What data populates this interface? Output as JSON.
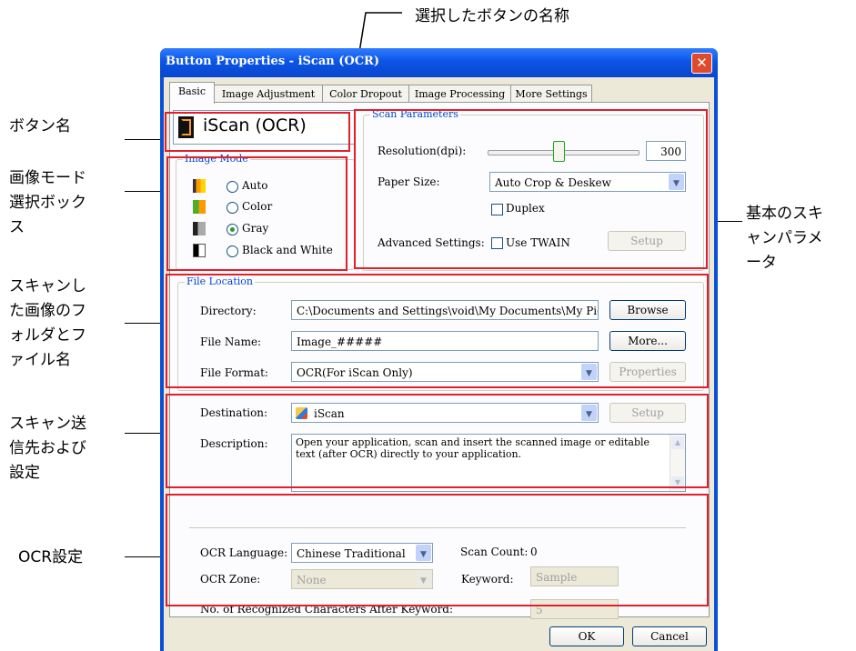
{
  "annotations": {
    "top": "選択したボタンの名称",
    "button_name": "ボタン名",
    "image_mode": [
      "画像モード",
      "選択ボック",
      "ス"
    ],
    "scan_params": [
      "基本のスキ",
      "ャンパラメ",
      "ータ"
    ],
    "file_location": [
      "スキャンし",
      "た画像のフ",
      "ォルダとフ",
      "ァイル名"
    ],
    "destination": [
      "スキャン送",
      "信先および",
      "設定"
    ],
    "ocr": "OCR設定"
  },
  "dialog": {
    "title": "Button Properties - iScan (OCR)",
    "close_glyph": "✕",
    "tabs": [
      "Basic",
      "Image Adjustment",
      "Color Dropout",
      "Image Processing",
      "More Settings"
    ],
    "button_name": "iScan (OCR)",
    "image_mode": {
      "label": "Image Mode",
      "options": [
        "Auto",
        "Color",
        "Gray",
        "Black and White"
      ],
      "selected": "Gray"
    },
    "scan_parameters": {
      "label": "Scan Parameters",
      "resolution_label": "Resolution(dpi):",
      "resolution_value": "300",
      "resolution_level": 0.47,
      "paper_size_label": "Paper Size:",
      "paper_size_value": "Auto Crop & Deskew",
      "duplex_label": "Duplex",
      "advanced_label": "Advanced Settings:",
      "use_twain_label": "Use TWAIN",
      "setup_label": "Setup"
    },
    "file_location": {
      "label": "File Location",
      "directory_label": "Directory:",
      "directory_value": "C:\\Documents and Settings\\void\\My Documents\\My Pictures",
      "browse_label": "Browse",
      "file_name_label": "File Name:",
      "file_name_value": "Image_#####",
      "more_label": "More...",
      "file_format_label": "File Format:",
      "file_format_value": "OCR(For iScan Only)",
      "properties_label": "Properties"
    },
    "destination": {
      "label": "Destination:",
      "value": "iScan",
      "setup_label": "Setup",
      "description_label": "Description:",
      "description_text": "Open your application, scan and insert the scanned image or editable text (after OCR) directly to your application."
    },
    "ocr": {
      "language_label": "OCR Language:",
      "language_value": "Chinese Traditional",
      "scan_count_label": "Scan Count:",
      "scan_count_value": "0",
      "zone_label": "OCR Zone:",
      "zone_value": "None",
      "keyword_label": "Keyword:",
      "keyword_placeholder": "Sample",
      "recognized_label": "No. of Recognized Characters After Keyword:",
      "recognized_value": "5"
    },
    "ok_label": "OK",
    "cancel_label": "Cancel"
  },
  "colors": {
    "highlight": "#e0202a",
    "titlebar": "#0b55e6",
    "group_label": "#0046d5"
  }
}
